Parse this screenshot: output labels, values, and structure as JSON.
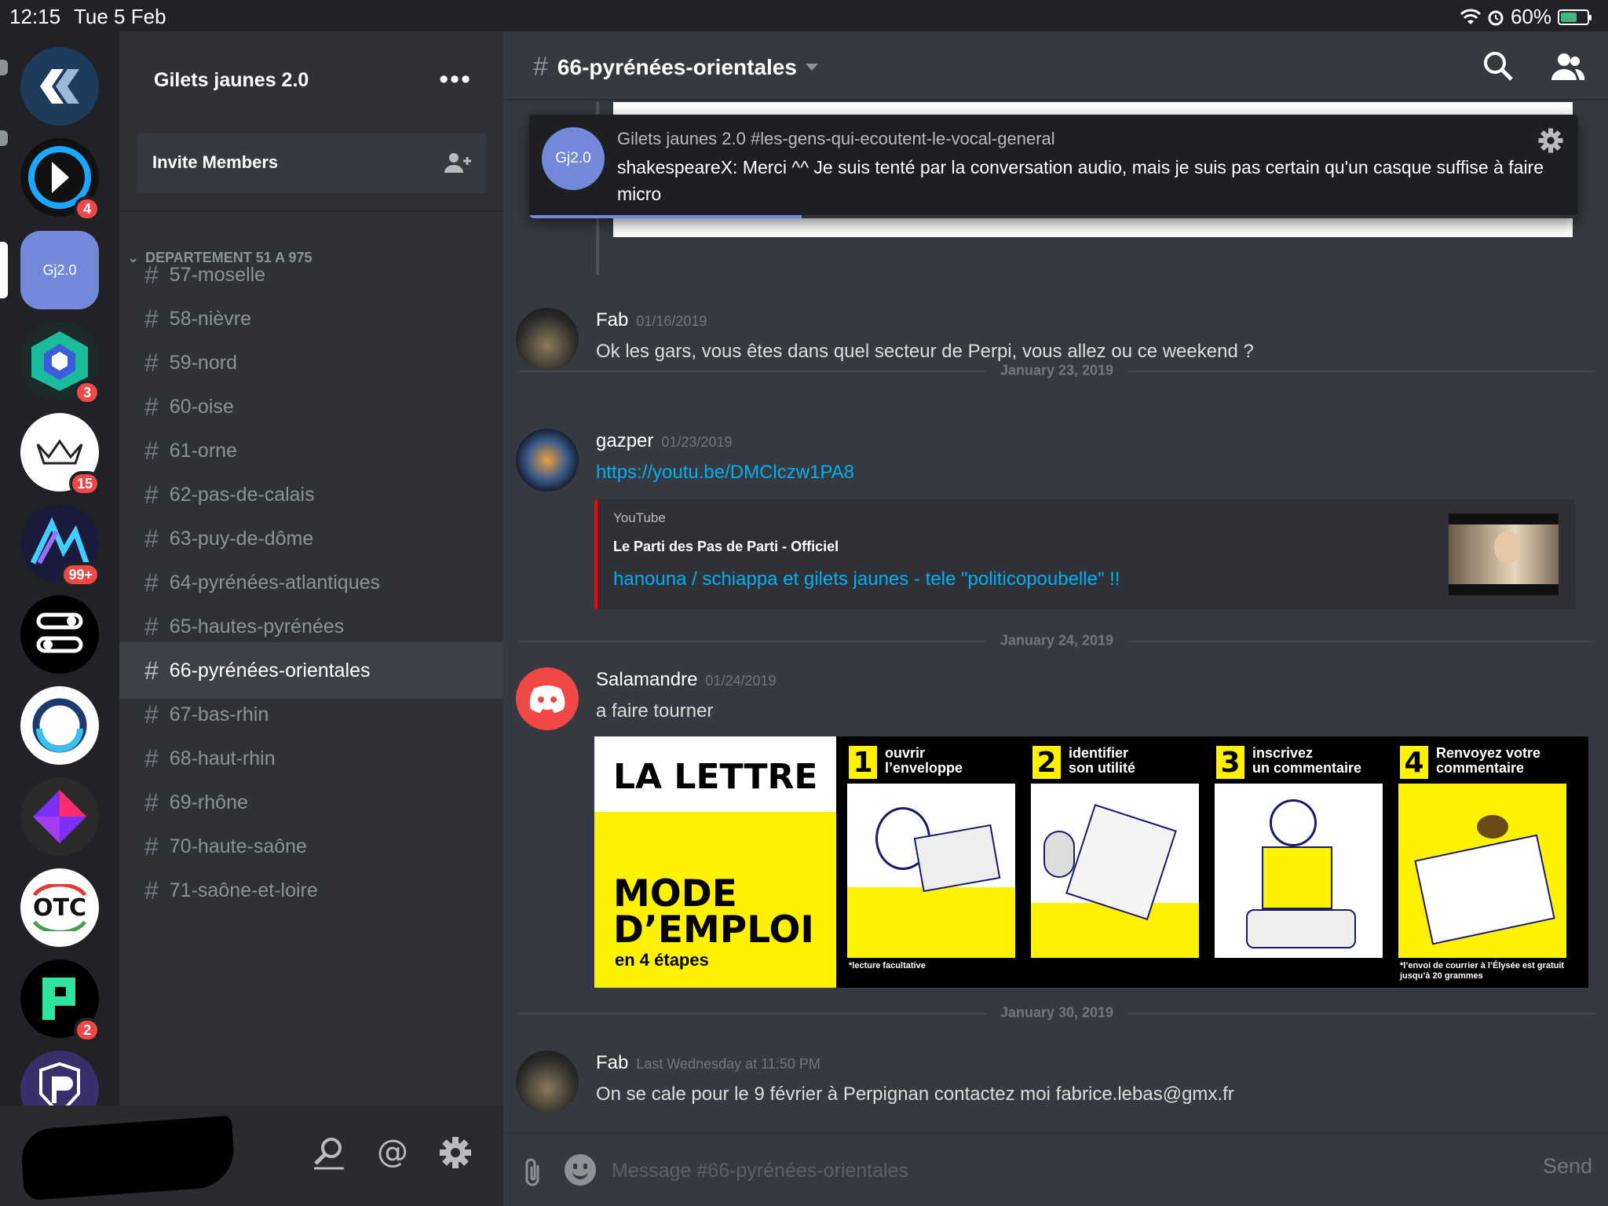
{
  "status_bar": {
    "time": "12:15",
    "date": "Tue 5 Feb",
    "battery": "60%",
    "battery_level": 0.6
  },
  "servers": [
    {
      "label": "",
      "icon": "arrow-logo-icon",
      "badge": ""
    },
    {
      "label": "",
      "icon": "k-logo-icon",
      "badge": "4"
    },
    {
      "label": "Gj2.0",
      "icon": "",
      "badge": ""
    },
    {
      "label": "",
      "icon": "hex-logo-icon",
      "badge": "3"
    },
    {
      "label": "",
      "icon": "crown-logo-icon",
      "badge": "15"
    },
    {
      "label": "",
      "icon": "wave-logo-icon",
      "badge": "99+"
    },
    {
      "label": "",
      "icon": "nodes-logo-icon",
      "badge": ""
    },
    {
      "label": "",
      "icon": "ring-logo-icon",
      "badge": ""
    },
    {
      "label": "",
      "icon": "diamond-logo-icon",
      "badge": ""
    },
    {
      "label": "",
      "icon": "otc-logo-icon",
      "badge": ""
    },
    {
      "label": "",
      "icon": "p-logo-icon",
      "badge": "2"
    },
    {
      "label": "",
      "icon": "p-shield-logo-icon",
      "badge": ""
    }
  ],
  "guild": {
    "name": "Gilets jaunes 2.0",
    "menu": "•••",
    "invite": "Invite Members"
  },
  "category": "DEPARTEMENT 51 A 975",
  "channels": [
    {
      "name": "57-moselle"
    },
    {
      "name": "58-nièvre"
    },
    {
      "name": "59-nord"
    },
    {
      "name": "60-oise"
    },
    {
      "name": "61-orne"
    },
    {
      "name": "62-pas-de-calais"
    },
    {
      "name": "63-puy-de-dôme"
    },
    {
      "name": "64-pyrénées-atlantiques"
    },
    {
      "name": "65-hautes-pyrénées"
    },
    {
      "name": "66-pyrénées-orientales"
    },
    {
      "name": "67-bas-rhin"
    },
    {
      "name": "68-haut-rhin"
    },
    {
      "name": "69-rhône"
    },
    {
      "name": "70-haute-saône"
    },
    {
      "name": "71-saône-et-loire"
    }
  ],
  "active_channel": "66-pyrénées-orientales",
  "chat": {
    "title": "66-pyrénées-orientales",
    "hash": "#"
  },
  "toast": {
    "avatar": "Gj2.0",
    "context": "Gilets jaunes 2.0 #les-gens-qui-ecoutent-le-vocal-general",
    "text": "shakespeareX: Merci ^^ Je suis tenté par la conversation audio, mais je suis pas certain qu'un casque suffise à faire micro",
    "progress": 0.26
  },
  "messages": [
    {
      "author": "Fab",
      "time": "01/16/2019",
      "text": "Ok les gars, vous êtes dans quel secteur de Perpi, vous allez ou ce weekend ?"
    },
    {
      "author": "gazper",
      "time": "01/23/2019",
      "text": "https://youtu.be/DMClczw1PA8"
    },
    {
      "author": "Salamandre",
      "time": "01/24/2019",
      "text": "a faire tourner"
    },
    {
      "author": "Fab",
      "time": "Last Wednesday at 11:50 PM",
      "text": "On se cale pour le 9 février à Perpignan contactez moi fabrice.lebas@gmx.fr"
    }
  ],
  "dividers": [
    "January 23, 2019",
    "January 24, 2019",
    "January 30, 2019"
  ],
  "embed": {
    "provider": "YouTube",
    "author": "Le Parti des Pas de Parti - Officiel",
    "title": "hanouna / schiappa et gilets jaunes - tele \"politicopoubelle\" !!"
  },
  "infographic": {
    "title": "LA LETTRE",
    "mode_line1": "MODE",
    "mode_line2": "D’EMPLOI",
    "subtitle": "en 4 étapes",
    "steps": [
      {
        "num": "1",
        "line1": "ouvrir",
        "line2": "l’enveloppe",
        "note": "*lecture facultative"
      },
      {
        "num": "2",
        "line1": "identifier",
        "line2": "son utilité",
        "note": ""
      },
      {
        "num": "3",
        "line1": "inscrivez",
        "line2": "un commentaire",
        "note": ""
      },
      {
        "num": "4",
        "line1": "Renvoyez votre",
        "line2": "commentaire",
        "note": "*l’envoi de courrier à l’Élysée est gratuit jusqu’à 20 grammes"
      }
    ]
  },
  "composer": {
    "placeholder": "Message #66-pyrénées-orientales",
    "send": "Send"
  },
  "colors": {
    "accent": "#7289da",
    "link": "#00b0f4",
    "badge": "#f04747",
    "youtube": "#ff0000",
    "infographic_yellow": "#fff200"
  }
}
